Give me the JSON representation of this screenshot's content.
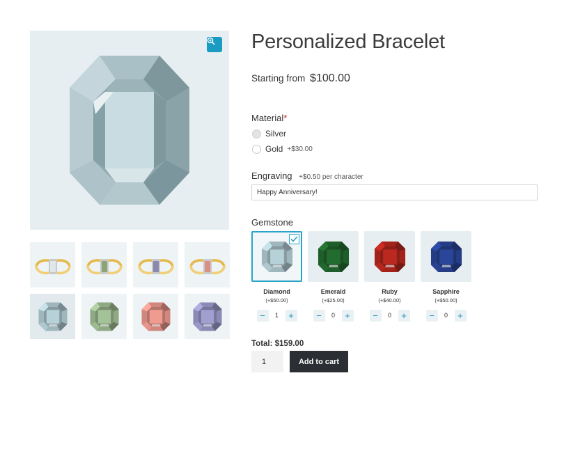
{
  "product": {
    "title": "Personalized Bracelet",
    "price_prefix": "Starting from",
    "price": "$100.00"
  },
  "gallery": {
    "zoom_icon": "zoom-in-icon",
    "thumbnails": [
      {
        "kind": "bracelet",
        "stone_color": "#dfe7ea"
      },
      {
        "kind": "bracelet",
        "stone_color": "#8aa377"
      },
      {
        "kind": "bracelet",
        "stone_color": "#8a89ad"
      },
      {
        "kind": "bracelet",
        "stone_color": "#d98f83"
      },
      {
        "kind": "gem",
        "color": "#9fb6bd",
        "active": true
      },
      {
        "kind": "gem",
        "color": "#8fa984"
      },
      {
        "kind": "gem",
        "color": "#d1877d"
      },
      {
        "kind": "gem",
        "color": "#8c8ab5"
      }
    ]
  },
  "material": {
    "label": "Material",
    "required_mark": "*",
    "options": [
      {
        "label": "Silver",
        "addon": "",
        "checked": true
      },
      {
        "label": "Gold",
        "addon": "+$30.00",
        "checked": false
      }
    ]
  },
  "engraving": {
    "label": "Engraving",
    "addon": "+$0.50 per character",
    "value": "Happy Anniversary!"
  },
  "gemstone": {
    "label": "Gemstone",
    "items": [
      {
        "name": "Diamond",
        "price": "(+$50.00)",
        "qty": "1",
        "color": "#9fb6bd",
        "selected": true
      },
      {
        "name": "Emerald",
        "price": "(+$25.00)",
        "qty": "0",
        "color": "#1e5e2a",
        "selected": false
      },
      {
        "name": "Ruby",
        "price": "(+$40.00)",
        "qty": "0",
        "color": "#a3231b",
        "selected": false
      },
      {
        "name": "Sapphire",
        "price": "(+$50.00)",
        "qty": "0",
        "color": "#243d86",
        "selected": false
      }
    ],
    "minus_label": "−",
    "plus_label": "+"
  },
  "cart": {
    "total": "Total: $159.00",
    "quantity": "1",
    "add_label": "Add to cart"
  }
}
